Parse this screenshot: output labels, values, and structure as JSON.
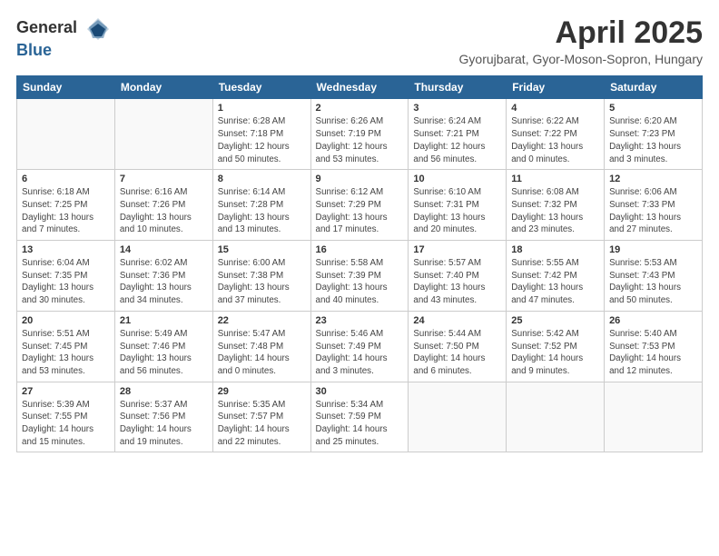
{
  "header": {
    "logo_general": "General",
    "logo_blue": "Blue",
    "month": "April 2025",
    "location": "Gyorujbarat, Gyor-Moson-Sopron, Hungary"
  },
  "weekdays": [
    "Sunday",
    "Monday",
    "Tuesday",
    "Wednesday",
    "Thursday",
    "Friday",
    "Saturday"
  ],
  "weeks": [
    [
      {
        "date": "",
        "info": ""
      },
      {
        "date": "",
        "info": ""
      },
      {
        "date": "1",
        "info": "Sunrise: 6:28 AM\nSunset: 7:18 PM\nDaylight: 12 hours\nand 50 minutes."
      },
      {
        "date": "2",
        "info": "Sunrise: 6:26 AM\nSunset: 7:19 PM\nDaylight: 12 hours\nand 53 minutes."
      },
      {
        "date": "3",
        "info": "Sunrise: 6:24 AM\nSunset: 7:21 PM\nDaylight: 12 hours\nand 56 minutes."
      },
      {
        "date": "4",
        "info": "Sunrise: 6:22 AM\nSunset: 7:22 PM\nDaylight: 13 hours\nand 0 minutes."
      },
      {
        "date": "5",
        "info": "Sunrise: 6:20 AM\nSunset: 7:23 PM\nDaylight: 13 hours\nand 3 minutes."
      }
    ],
    [
      {
        "date": "6",
        "info": "Sunrise: 6:18 AM\nSunset: 7:25 PM\nDaylight: 13 hours\nand 7 minutes."
      },
      {
        "date": "7",
        "info": "Sunrise: 6:16 AM\nSunset: 7:26 PM\nDaylight: 13 hours\nand 10 minutes."
      },
      {
        "date": "8",
        "info": "Sunrise: 6:14 AM\nSunset: 7:28 PM\nDaylight: 13 hours\nand 13 minutes."
      },
      {
        "date": "9",
        "info": "Sunrise: 6:12 AM\nSunset: 7:29 PM\nDaylight: 13 hours\nand 17 minutes."
      },
      {
        "date": "10",
        "info": "Sunrise: 6:10 AM\nSunset: 7:31 PM\nDaylight: 13 hours\nand 20 minutes."
      },
      {
        "date": "11",
        "info": "Sunrise: 6:08 AM\nSunset: 7:32 PM\nDaylight: 13 hours\nand 23 minutes."
      },
      {
        "date": "12",
        "info": "Sunrise: 6:06 AM\nSunset: 7:33 PM\nDaylight: 13 hours\nand 27 minutes."
      }
    ],
    [
      {
        "date": "13",
        "info": "Sunrise: 6:04 AM\nSunset: 7:35 PM\nDaylight: 13 hours\nand 30 minutes."
      },
      {
        "date": "14",
        "info": "Sunrise: 6:02 AM\nSunset: 7:36 PM\nDaylight: 13 hours\nand 34 minutes."
      },
      {
        "date": "15",
        "info": "Sunrise: 6:00 AM\nSunset: 7:38 PM\nDaylight: 13 hours\nand 37 minutes."
      },
      {
        "date": "16",
        "info": "Sunrise: 5:58 AM\nSunset: 7:39 PM\nDaylight: 13 hours\nand 40 minutes."
      },
      {
        "date": "17",
        "info": "Sunrise: 5:57 AM\nSunset: 7:40 PM\nDaylight: 13 hours\nand 43 minutes."
      },
      {
        "date": "18",
        "info": "Sunrise: 5:55 AM\nSunset: 7:42 PM\nDaylight: 13 hours\nand 47 minutes."
      },
      {
        "date": "19",
        "info": "Sunrise: 5:53 AM\nSunset: 7:43 PM\nDaylight: 13 hours\nand 50 minutes."
      }
    ],
    [
      {
        "date": "20",
        "info": "Sunrise: 5:51 AM\nSunset: 7:45 PM\nDaylight: 13 hours\nand 53 minutes."
      },
      {
        "date": "21",
        "info": "Sunrise: 5:49 AM\nSunset: 7:46 PM\nDaylight: 13 hours\nand 56 minutes."
      },
      {
        "date": "22",
        "info": "Sunrise: 5:47 AM\nSunset: 7:48 PM\nDaylight: 14 hours\nand 0 minutes."
      },
      {
        "date": "23",
        "info": "Sunrise: 5:46 AM\nSunset: 7:49 PM\nDaylight: 14 hours\nand 3 minutes."
      },
      {
        "date": "24",
        "info": "Sunrise: 5:44 AM\nSunset: 7:50 PM\nDaylight: 14 hours\nand 6 minutes."
      },
      {
        "date": "25",
        "info": "Sunrise: 5:42 AM\nSunset: 7:52 PM\nDaylight: 14 hours\nand 9 minutes."
      },
      {
        "date": "26",
        "info": "Sunrise: 5:40 AM\nSunset: 7:53 PM\nDaylight: 14 hours\nand 12 minutes."
      }
    ],
    [
      {
        "date": "27",
        "info": "Sunrise: 5:39 AM\nSunset: 7:55 PM\nDaylight: 14 hours\nand 15 minutes."
      },
      {
        "date": "28",
        "info": "Sunrise: 5:37 AM\nSunset: 7:56 PM\nDaylight: 14 hours\nand 19 minutes."
      },
      {
        "date": "29",
        "info": "Sunrise: 5:35 AM\nSunset: 7:57 PM\nDaylight: 14 hours\nand 22 minutes."
      },
      {
        "date": "30",
        "info": "Sunrise: 5:34 AM\nSunset: 7:59 PM\nDaylight: 14 hours\nand 25 minutes."
      },
      {
        "date": "",
        "info": ""
      },
      {
        "date": "",
        "info": ""
      },
      {
        "date": "",
        "info": ""
      }
    ]
  ]
}
